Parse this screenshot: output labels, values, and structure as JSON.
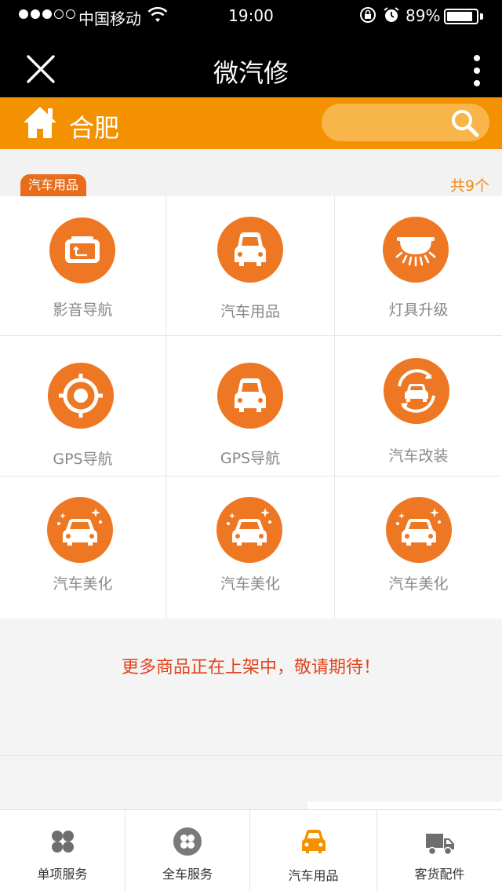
{
  "status_bar": {
    "carrier": "中国移动",
    "time": "19:00",
    "battery": "89%",
    "battery_level": 0.89
  },
  "nav": {
    "title": "微汽修"
  },
  "city_bar": {
    "city": "合肥",
    "search_placeholder": ""
  },
  "section": {
    "tag": "汽车用品",
    "count": "共9个"
  },
  "categories": [
    {
      "label": "影音导航",
      "icon": "media-nav-icon"
    },
    {
      "label": "汽车用品",
      "icon": "car-icon"
    },
    {
      "label": "灯具升级",
      "icon": "lamp-icon"
    },
    {
      "label": "GPS导航",
      "icon": "gps-target-icon"
    },
    {
      "label": "GPS导航",
      "icon": "car-icon"
    },
    {
      "label": "汽车改装",
      "icon": "car-modify-icon"
    },
    {
      "label": "汽车美化",
      "icon": "car-sparkle-icon"
    },
    {
      "label": "汽车美化",
      "icon": "car-sparkle-icon"
    },
    {
      "label": "汽车美化",
      "icon": "car-sparkle-icon"
    }
  ],
  "notice": "更多商品正在上架中，敬请期待！",
  "tabs": [
    {
      "label": "单项服务",
      "icon": "four-petal-icon",
      "active": false
    },
    {
      "label": "全车服务",
      "icon": "circle-petal-icon",
      "active": false
    },
    {
      "label": "汽车用品",
      "icon": "car-icon",
      "active": true
    },
    {
      "label": "客货配件",
      "icon": "truck-icon",
      "active": false
    }
  ],
  "colors": {
    "brand_orange": "#f39100",
    "icon_orange": "#ee7724",
    "notice_red": "#e2451f"
  }
}
